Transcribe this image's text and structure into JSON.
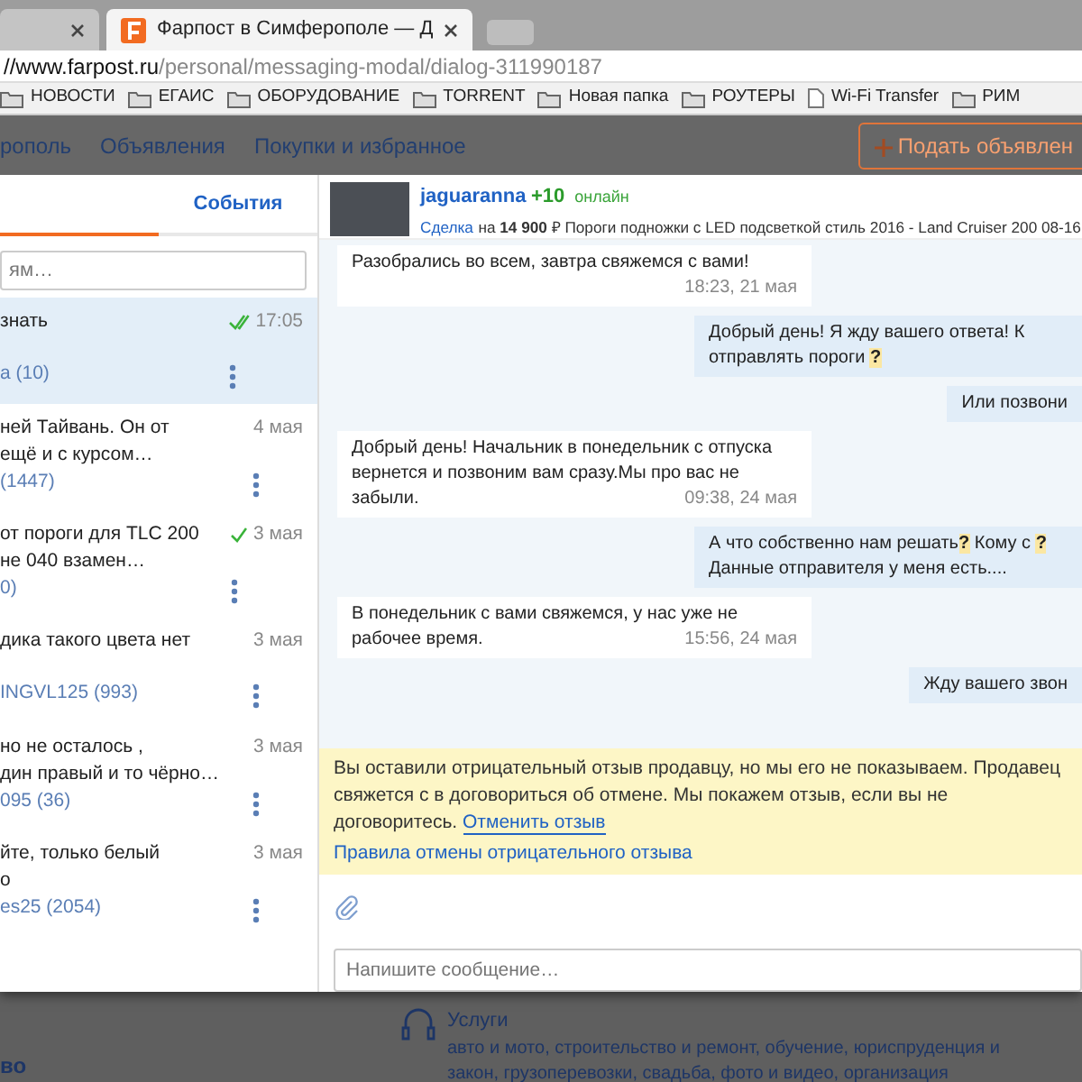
{
  "browser": {
    "tabs": [
      {
        "selected": false
      },
      {
        "title": "Фарпост в Симферополе — Д",
        "selected": true
      }
    ],
    "address": {
      "host": "//www.farpost.ru",
      "path": "/personal/messaging-modal/dialog-311990187"
    },
    "bookmarks": [
      {
        "label": "НОВОСТИ",
        "kind": "folder"
      },
      {
        "label": "ЕГАИС",
        "kind": "folder"
      },
      {
        "label": "ОБОРУДОВАНИЕ",
        "kind": "folder"
      },
      {
        "label": "TORRENT",
        "kind": "folder"
      },
      {
        "label": "Новая папка",
        "kind": "folder"
      },
      {
        "label": "РОУТЕРЫ",
        "kind": "folder"
      },
      {
        "label": "Wi-Fi Transfer",
        "kind": "page"
      },
      {
        "label": "РИМ",
        "kind": "folder"
      }
    ]
  },
  "site_nav": {
    "items": [
      "рополь",
      "Объявления",
      "Покупки и избранное"
    ],
    "post_button": "Подать объявлен"
  },
  "sidebar": {
    "tabs": [
      {
        "selected": true
      },
      {
        "label": "События",
        "selected": false
      }
    ],
    "search": {
      "placeholder": "ям…"
    },
    "items": [
      {
        "preview": [
          "знать"
        ],
        "time": "17:05",
        "sent": true,
        "read": true,
        "contact": "а (10)",
        "selected": true
      },
      {
        "preview": [
          "ней Тайвань. Он от",
          "ещё и с курсом…"
        ],
        "time": "4 мая",
        "sent": false,
        "read": false,
        "contact": "(1447)",
        "selected": false
      },
      {
        "preview": [
          "от пороги для TLC 200",
          "не 040 взамен…"
        ],
        "time": "3 мая",
        "sent": true,
        "read": false,
        "contact": "0)",
        "selected": false
      },
      {
        "preview": [
          "дика такого цвета нет"
        ],
        "time": "3 мая",
        "sent": false,
        "read": false,
        "contact": "INGVL125 (993)",
        "selected": false
      },
      {
        "preview": [
          "но не осталось ,",
          "дин правый и то чёрно…"
        ],
        "time": "3 мая",
        "sent": false,
        "read": false,
        "contact": "095 (36)",
        "selected": false
      },
      {
        "preview": [
          "йте, только белый",
          "о"
        ],
        "time": "3 мая",
        "sent": false,
        "read": false,
        "contact": "es25 (2054)",
        "selected": false
      }
    ]
  },
  "dialog": {
    "user": "jaguaranna",
    "rating": "+10",
    "status": "онлайн",
    "deal_link": "Сделка",
    "deal_text": "на **14 900** ₽ Пороги подножки с LED подсветкой стиль 2016 - Land Cruiser 200 08-16",
    "messages": [
      {
        "outgoing": false,
        "text": "Разобрались во всем, завтра свяжемся с вами!",
        "time": "18:23, 21 мая"
      },
      {
        "outgoing": true,
        "text": "Добрый день! Я жду вашего ответа! К отправлять пороги **?**"
      },
      {
        "outgoing": true,
        "text": "Или позвони"
      },
      {
        "outgoing": false,
        "text": "Добрый день! Начальник в понедельник с отпуска вернется и позвоним вам сразу.Мы про вас не забыли.",
        "time": "09:38, 24 мая"
      },
      {
        "outgoing": true,
        "text": "А что собственно нам решать**?** Кому с **?** Данные отправителя у меня есть...."
      },
      {
        "outgoing": false,
        "text": "В понедельник с вами свяжемся, у нас уже не рабочее время.",
        "time": "15:56, 24 мая"
      },
      {
        "outgoing": true,
        "text": "Жду вашего звон"
      }
    ],
    "notice": {
      "text": "Вы оставили отрицательный отзыв продавцу, но мы его не показываем. Продавец свяжется с в договориться об отмене. Мы покажем отзыв, если вы не договоритесь.",
      "cancel_link": "Отменить отзыв",
      "rules_link": "Правила отмены отрицательного отзыва"
    },
    "compose": {
      "placeholder": "Напишите сообщение…"
    }
  },
  "background": {
    "left_text": "во",
    "services_title": "Услуги",
    "services_text": "авто и мото, строительство и ремонт, обучение, юриспруденция и закон, грузоперевозки, свадьба, фото и видео, организация"
  }
}
